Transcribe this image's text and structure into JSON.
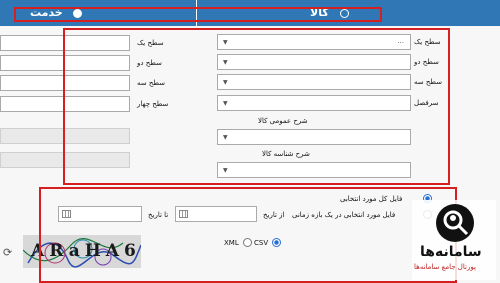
{
  "tabs": {
    "goods_label": "کالا",
    "service_label": "خدمت"
  },
  "goods_form": {
    "level1_label": "سطح یک",
    "level1_value": "...",
    "level2_label": "سطح دو",
    "level3_label": "سطح سه",
    "heading_label": "سرفصل",
    "general_desc_label": "شرح عمومی کالا",
    "id_desc_label": "شرح شناسه کالا"
  },
  "service_form": {
    "level1_label": "سطح یک",
    "level2_label": "سطح دو",
    "level3_label": "سطح سه",
    "level4_label": "سطح چهار"
  },
  "filter": {
    "option_all_selected": "فایل کل مورد انتخابی",
    "option_range": "فایل مورد انتخابی در یک بازه زمانی",
    "from_date_label": "از تاریخ",
    "to_date_label": "تا تاریخ",
    "format_csv": "CSV",
    "format_xml": "XML"
  },
  "captcha": {
    "text": "ARaHA6"
  },
  "watermark": {
    "line1": "سامانه‌ها",
    "line2": "پورتال جامع سامانه‌ها"
  },
  "colors": {
    "topbar": "#2f78b5",
    "highlight": "#d42020"
  }
}
